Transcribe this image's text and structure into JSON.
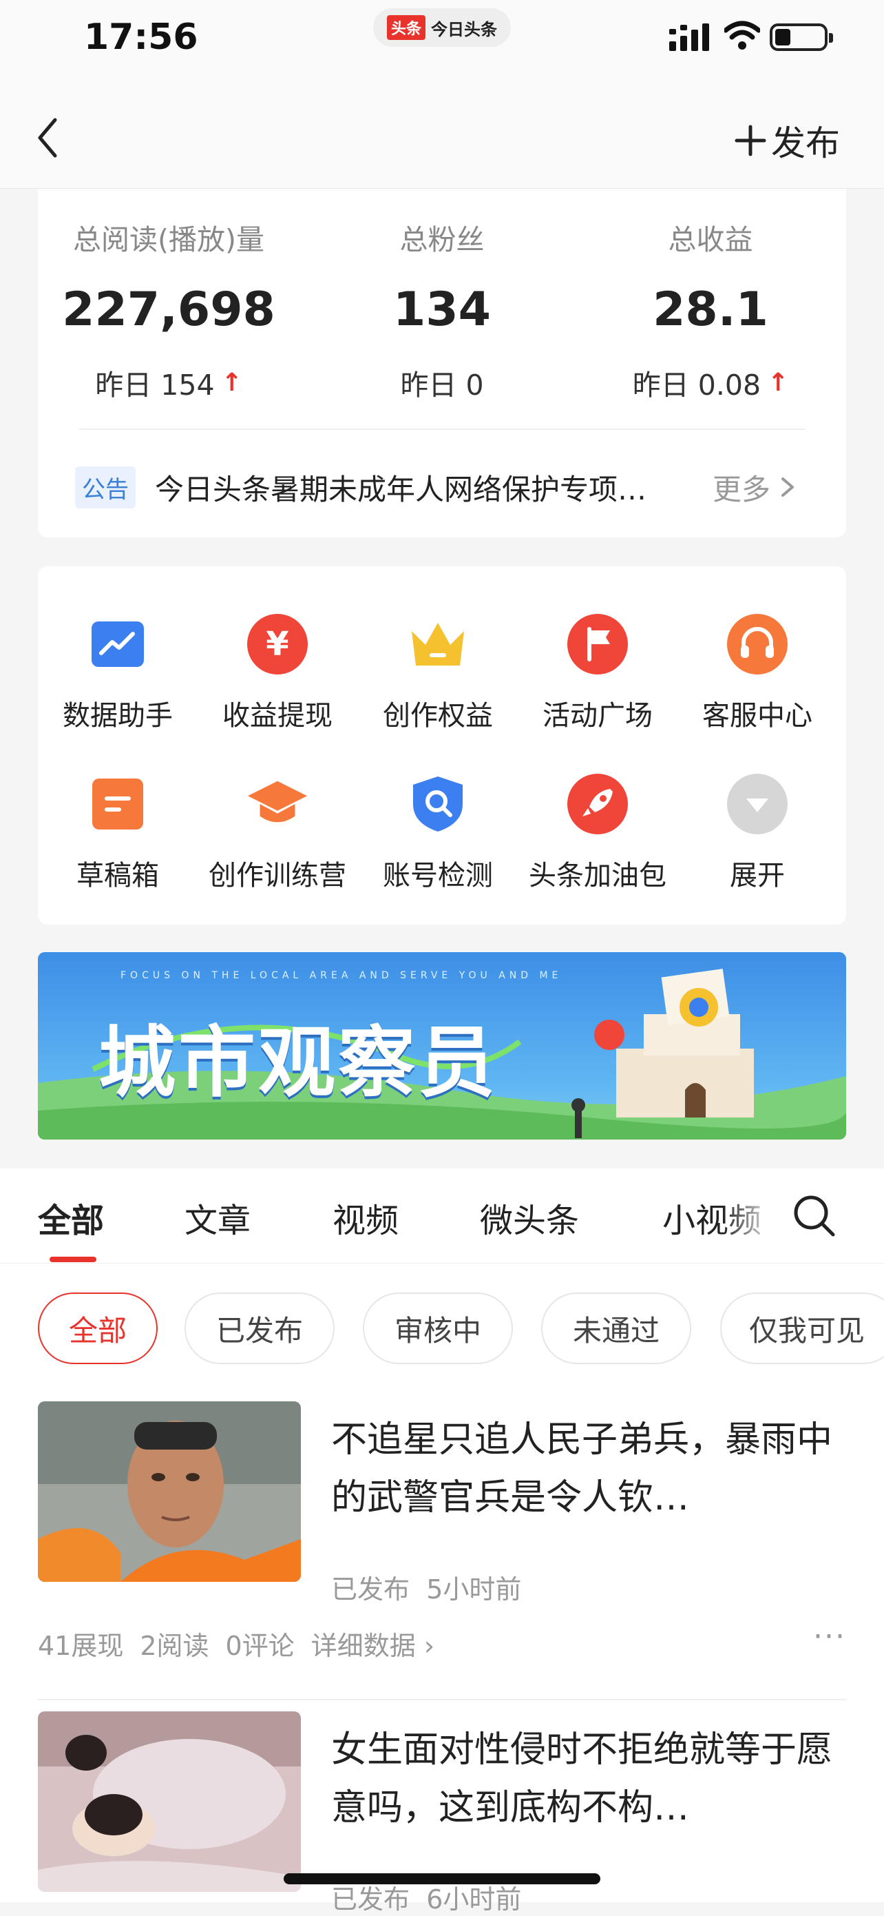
{
  "status_bar": {
    "time": "17:56",
    "app_badge": "头条",
    "app_name": "今日头条"
  },
  "nav": {
    "back_icon": "chevron-left-icon",
    "publish_label": "发布",
    "publish_icon": "plus-icon"
  },
  "stats": [
    {
      "label": "总阅读(播放)量",
      "value": "227,698",
      "yesterday": "昨日 154",
      "trend": "up"
    },
    {
      "label": "总粉丝",
      "value": "134",
      "yesterday": "昨日 0",
      "trend": "none"
    },
    {
      "label": "总收益",
      "value": "28.1",
      "yesterday": "昨日 0.08",
      "trend": "up"
    }
  ],
  "notice": {
    "tag": "公告",
    "text": "今日头条暑期未成年人网络保护专项…",
    "more": "更多"
  },
  "tools": [
    {
      "label": "数据助手",
      "icon": "chart-icon",
      "color": "#3b7ff0"
    },
    {
      "label": "收益提现",
      "icon": "yen-icon",
      "color": "#f0463a"
    },
    {
      "label": "创作权益",
      "icon": "crown-icon",
      "color": "#f5c12e"
    },
    {
      "label": "活动广场",
      "icon": "flag-icon",
      "color": "#f0463a"
    },
    {
      "label": "客服中心",
      "icon": "headset-icon",
      "color": "#f6783a"
    },
    {
      "label": "草稿箱",
      "icon": "draft-icon",
      "color": "#f6783a"
    },
    {
      "label": "创作训练营",
      "icon": "graduation-cap-icon",
      "color": "#f6783a"
    },
    {
      "label": "账号检测",
      "icon": "shield-search-icon",
      "color": "#3b7ff0"
    },
    {
      "label": "头条加油包",
      "icon": "rocket-icon",
      "color": "#f0463a"
    },
    {
      "label": "展开",
      "icon": "chevron-down-icon",
      "color": "#d6d6d6"
    }
  ],
  "banner": {
    "title": "城市观察员",
    "subtitle": "FOCUS ON THE LOCAL AREA AND SERVE YOU AND ME"
  },
  "tabs": [
    "全部",
    "文章",
    "视频",
    "微头条",
    "小视频"
  ],
  "filters": [
    "全部",
    "已发布",
    "审核中",
    "未通过",
    "仅我可见"
  ],
  "articles": [
    {
      "title": "不追星只追人民子弟兵，暴雨中的武警官兵是令人钦…",
      "status": "已发布",
      "time": "5小时前",
      "impressions": "41展现",
      "reads": "2阅读",
      "comments": "0评论",
      "detail": "详细数据"
    },
    {
      "title": "女生面对性侵时不拒绝就等于愿意吗，这到底构不构…",
      "status": "已发布",
      "time": "6小时前"
    }
  ],
  "colors": {
    "accent": "#e8332d",
    "notice_tag": "#3a7fd8",
    "muted": "#999999"
  }
}
